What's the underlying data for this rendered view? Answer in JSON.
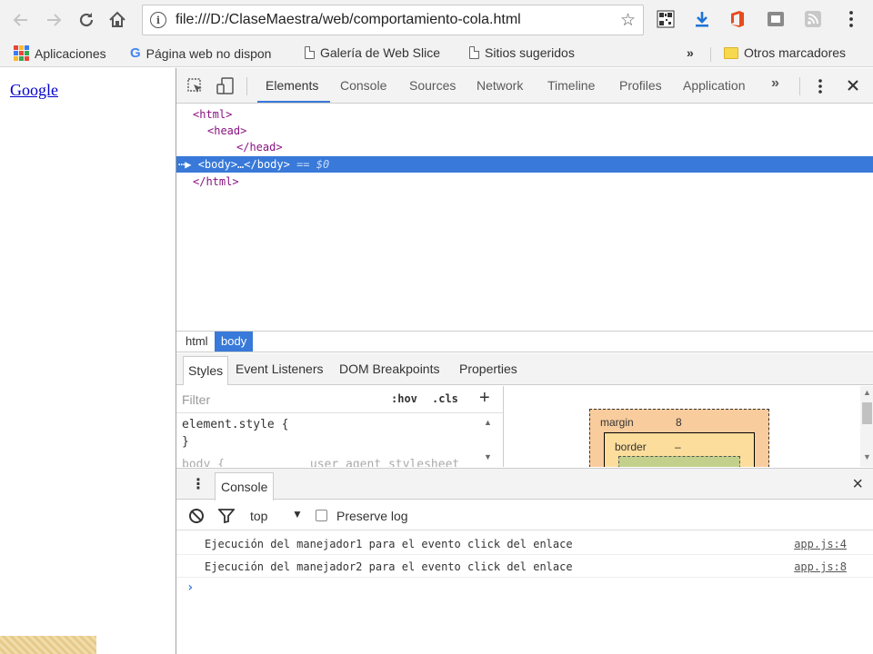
{
  "browser": {
    "url": "file:///D:/ClaseMaestra/web/comportamiento-cola.html",
    "nav_back_icon": "arrow-left-icon",
    "nav_forward_icon": "arrow-right-icon",
    "reload_icon": "reload-icon",
    "home_icon": "home-icon",
    "bookmark_star_icon": "star-icon",
    "extensions": [
      "qr-code-icon",
      "download-icon",
      "office-icon",
      "cast-icon",
      "rss-icon",
      "kebab-menu-icon"
    ]
  },
  "bookmarks": {
    "apps": "Aplicaciones",
    "items": [
      "Página web no dispon",
      "Galería de Web Slice",
      "Sitios sugeridos"
    ],
    "overflow": "»",
    "other": "Otros marcadores"
  },
  "page": {
    "link": "Google"
  },
  "devtools": {
    "tabs": [
      "Elements",
      "Console",
      "Sources",
      "Network",
      "Timeline",
      "Profiles",
      "Application"
    ],
    "active_tab": "Elements",
    "more": "»",
    "tree": {
      "line1": "<html>",
      "line2": "<head>",
      "line3": "</head>",
      "line4_tag": "<body>…</body>",
      "line4_eq": " == $0",
      "line5": "</html>"
    },
    "breadcrumb": [
      "html",
      "body"
    ],
    "subtabs": [
      "Styles",
      "Event Listeners",
      "DOM Breakpoints",
      "Properties"
    ],
    "styles": {
      "filter_placeholder": "Filter",
      "hov": ":hov",
      "cls": ".cls",
      "add": "+",
      "rule1": "element.style {",
      "rule1_end": "}",
      "rule2": "body {            user agent stylesheet"
    },
    "box_model": {
      "margin_label": "margin",
      "margin_value": "8",
      "border_label": "border",
      "border_value": "–"
    },
    "console": {
      "tab": "Console",
      "context": "top",
      "preserve_log": "Preserve log",
      "messages": [
        {
          "text": "Ejecución del manejador1 para el evento click del enlace",
          "source": "app.js:4"
        },
        {
          "text": "Ejecución del manejador2 para el evento click del enlace",
          "source": "app.js:8"
        }
      ],
      "prompt": "›"
    }
  }
}
